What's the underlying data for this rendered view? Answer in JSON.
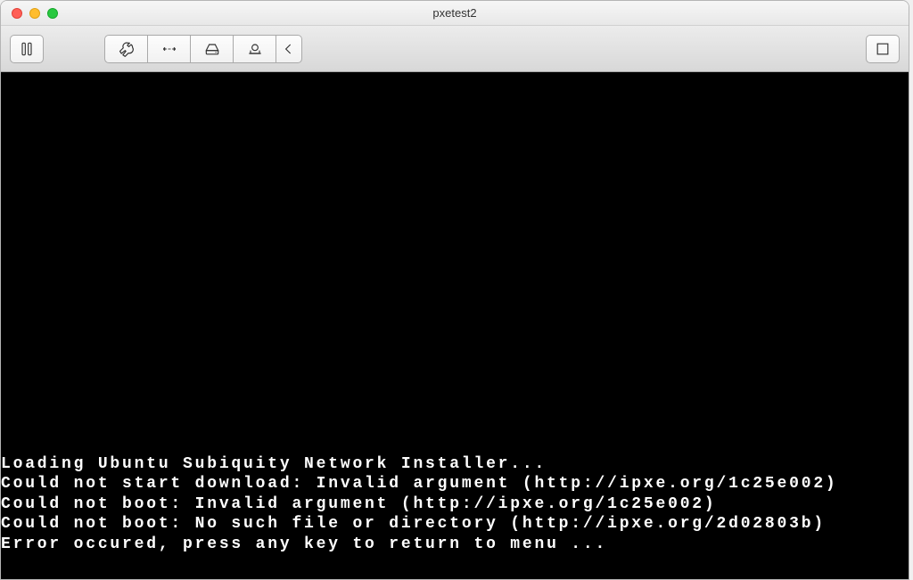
{
  "window": {
    "title": "pxetest2"
  },
  "toolbar": {
    "pause_label": "Pause",
    "settings_label": "Settings",
    "resize_label": "Resize",
    "disk_label": "Disk",
    "camera_label": "Snapshot",
    "collapse_label": "Collapse",
    "fullscreen_label": "Fullscreen"
  },
  "console": {
    "lines": [
      "Loading Ubuntu Subiquity Network Installer...",
      "Could not start download: Invalid argument (http://ipxe.org/1c25e002)",
      "Could not boot: Invalid argument (http://ipxe.org/1c25e002)",
      "Could not boot: No such file or directory (http://ipxe.org/2d02803b)",
      "Error occured, press any key to return to menu ..."
    ]
  }
}
